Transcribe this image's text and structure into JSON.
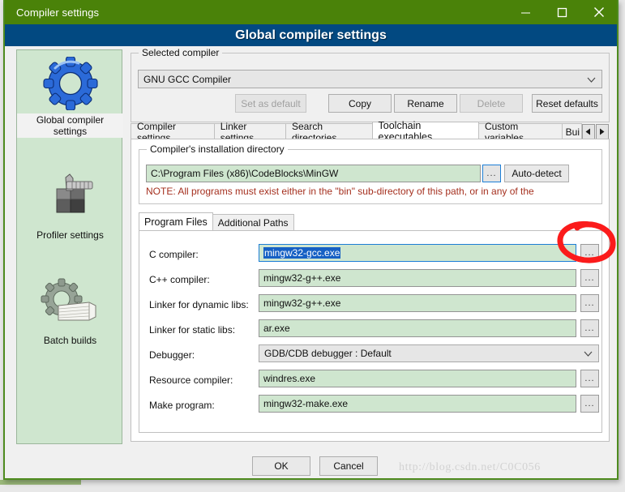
{
  "window": {
    "title": "Compiler settings",
    "controls": {
      "minimize": "minimize-icon",
      "maximize": "maximize-icon",
      "close": "close-icon"
    },
    "header_title": "Global compiler settings"
  },
  "sidebar": {
    "items": [
      {
        "label": "Global compiler settings",
        "icon": "gear-icon",
        "selected": true
      },
      {
        "label": "Profiler settings",
        "icon": "caliper-icon",
        "selected": false
      },
      {
        "label": "Batch builds",
        "icon": "gear-stack-icon",
        "selected": false
      }
    ]
  },
  "selected_compiler": {
    "group_label": "Selected compiler",
    "value": "GNU GCC Compiler",
    "dropdown_icon": "chevron-down-icon",
    "buttons": [
      {
        "label": "Set as default",
        "enabled": false
      },
      {
        "label": "Copy",
        "enabled": true
      },
      {
        "label": "Rename",
        "enabled": true
      },
      {
        "label": "Delete",
        "enabled": false
      },
      {
        "label": "Reset defaults",
        "enabled": true
      }
    ]
  },
  "main_tabs": {
    "items": [
      {
        "label": "Compiler settings",
        "active": false
      },
      {
        "label": "Linker settings",
        "active": false
      },
      {
        "label": "Search directories",
        "active": false
      },
      {
        "label": "Toolchain executables",
        "active": true
      },
      {
        "label": "Custom variables",
        "active": false
      },
      {
        "label": "Bui",
        "active": false
      }
    ],
    "scroll_left_icon": "triangle-left-icon",
    "scroll_right_icon": "triangle-right-icon"
  },
  "install_dir": {
    "group_label": "Compiler's installation directory",
    "value": "C:\\Program Files (x86)\\CodeBlocks\\MinGW",
    "browse_label": "...",
    "autodetect_label": "Auto-detect",
    "note": "NOTE: All programs must exist either in the \"bin\" sub-directory of this path, or in any of the"
  },
  "inner_tabs": {
    "items": [
      {
        "label": "Program Files",
        "active": true
      },
      {
        "label": "Additional Paths",
        "active": false
      }
    ]
  },
  "program_files": {
    "browse_label": "...",
    "dropdown_icon": "chevron-down-icon",
    "rows": [
      {
        "label": "C compiler:",
        "value": "mingw32-gcc.exe",
        "type": "text",
        "focused": true,
        "selected": true,
        "annotated": true
      },
      {
        "label": "C++ compiler:",
        "value": "mingw32-g++.exe",
        "type": "text",
        "focused": false,
        "selected": false,
        "annotated": false
      },
      {
        "label": "Linker for dynamic libs:",
        "value": "mingw32-g++.exe",
        "type": "text",
        "focused": false,
        "selected": false,
        "annotated": false
      },
      {
        "label": "Linker for static libs:",
        "value": "ar.exe",
        "type": "text",
        "focused": false,
        "selected": false,
        "annotated": false
      },
      {
        "label": "Debugger:",
        "value": "GDB/CDB debugger : Default",
        "type": "combo",
        "focused": false,
        "selected": false,
        "annotated": false
      },
      {
        "label": "Resource compiler:",
        "value": "windres.exe",
        "type": "text",
        "focused": false,
        "selected": false,
        "annotated": false
      },
      {
        "label": "Make program:",
        "value": "mingw32-make.exe",
        "type": "text",
        "focused": false,
        "selected": false,
        "annotated": false
      }
    ]
  },
  "footer": {
    "ok_label": "OK",
    "cancel_label": "Cancel",
    "watermark": "http://blog.csdn.net/C0C056"
  },
  "colors": {
    "titlebar": "#4a8209",
    "header_band": "#024981",
    "field_green": "#cfe6cf",
    "note_red": "#a5301f",
    "annotation_red": "#fb1b1b",
    "selection_blue": "#1660c4"
  }
}
